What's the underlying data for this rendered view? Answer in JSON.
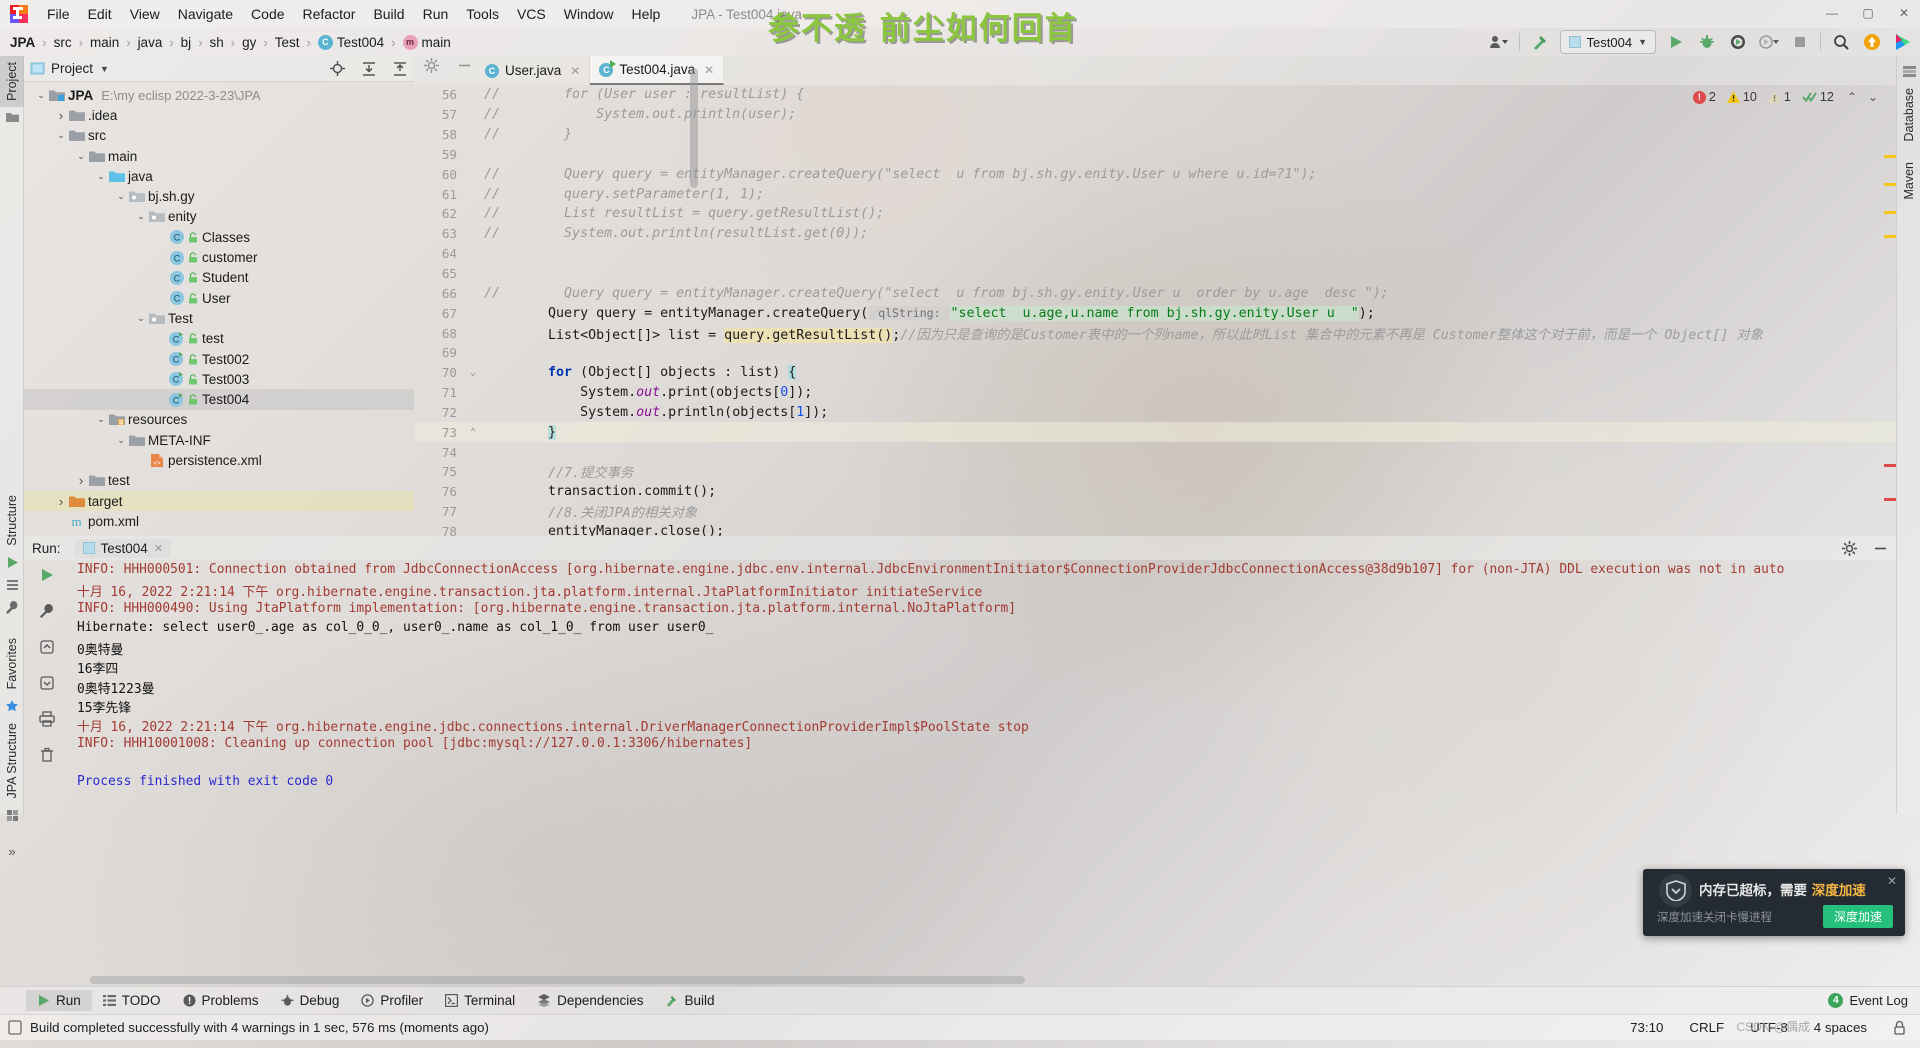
{
  "window": {
    "title": "JPA - Test004.java",
    "watermark": "参不透 前尘如何回首",
    "minimize": "—",
    "maximize": "▢",
    "close": "✕"
  },
  "menubar": {
    "items": [
      "File",
      "Edit",
      "View",
      "Navigate",
      "Code",
      "Refactor",
      "Build",
      "Run",
      "Tools",
      "VCS",
      "Window",
      "Help"
    ]
  },
  "breadcrumb": {
    "items": [
      {
        "label": "JPA",
        "icon": "",
        "bold": true
      },
      {
        "label": "src",
        "icon": ""
      },
      {
        "label": "main",
        "icon": ""
      },
      {
        "label": "java",
        "icon": ""
      },
      {
        "label": "bj",
        "icon": ""
      },
      {
        "label": "sh",
        "icon": ""
      },
      {
        "label": "gy",
        "icon": ""
      },
      {
        "label": "Test",
        "icon": ""
      },
      {
        "label": "Test004",
        "icon": "class-icon"
      },
      {
        "label": "main",
        "icon": "method-icon"
      }
    ]
  },
  "toolbar": {
    "run_config": "Test004",
    "icons": [
      "user-dropdown-icon",
      "build-hammer-icon",
      "run-icon",
      "debug-icon",
      "run-coverage-icon",
      "profiler-icon",
      "stop-icon",
      "search-everywhere-icon",
      "update-icon",
      "idea-feature-icon"
    ]
  },
  "left_strip": {
    "labels": [
      "Project",
      "Structure",
      "Favorites",
      "JPA Structure"
    ]
  },
  "right_strip": {
    "labels": [
      "Database",
      "Maven"
    ]
  },
  "project_panel": {
    "title": "Project",
    "header_icons": [
      "locate-icon",
      "expand-all-icon",
      "collapse-all-icon",
      "settings-gear-icon",
      "hide-icon"
    ],
    "tree": [
      {
        "depth": 0,
        "caret": "v",
        "icon": "module-folder",
        "label": "JPA",
        "bold": true,
        "path": "E:\\my eclisp 2022-3-23\\JPA"
      },
      {
        "depth": 1,
        "caret": ">",
        "icon": "folder",
        "label": ".idea"
      },
      {
        "depth": 1,
        "caret": "v",
        "icon": "folder",
        "label": "src"
      },
      {
        "depth": 2,
        "caret": "v",
        "icon": "folder",
        "label": "main"
      },
      {
        "depth": 3,
        "caret": "v",
        "icon": "source-folder",
        "label": "java"
      },
      {
        "depth": 4,
        "caret": "v",
        "icon": "package",
        "label": "bj.sh.gy"
      },
      {
        "depth": 5,
        "caret": "v",
        "icon": "package",
        "label": "enity"
      },
      {
        "depth": 6,
        "caret": "",
        "icon": "class",
        "label": "Classes"
      },
      {
        "depth": 6,
        "caret": "",
        "icon": "class",
        "label": "customer"
      },
      {
        "depth": 6,
        "caret": "",
        "icon": "class",
        "label": "Student"
      },
      {
        "depth": 6,
        "caret": "",
        "icon": "class",
        "label": "User"
      },
      {
        "depth": 5,
        "caret": "v",
        "icon": "package",
        "label": "Test"
      },
      {
        "depth": 6,
        "caret": "",
        "icon": "runnable-class",
        "label": "test"
      },
      {
        "depth": 6,
        "caret": "",
        "icon": "runnable-class",
        "label": "Test002"
      },
      {
        "depth": 6,
        "caret": "",
        "icon": "runnable-class",
        "label": "Test003"
      },
      {
        "depth": 6,
        "caret": "",
        "icon": "runnable-class",
        "label": "Test004",
        "selected": true
      },
      {
        "depth": 3,
        "caret": "v",
        "icon": "resource-folder",
        "label": "resources"
      },
      {
        "depth": 4,
        "caret": "v",
        "icon": "folder",
        "label": "META-INF"
      },
      {
        "depth": 5,
        "caret": "",
        "icon": "xml-file",
        "label": "persistence.xml"
      },
      {
        "depth": 2,
        "caret": ">",
        "icon": "folder",
        "label": "test"
      },
      {
        "depth": 1,
        "caret": ">",
        "icon": "target-folder",
        "label": "target",
        "target": true
      },
      {
        "depth": 1,
        "caret": "",
        "icon": "maven-file",
        "label": "pom.xml"
      }
    ]
  },
  "editor": {
    "tabs": [
      {
        "label": "User.java",
        "icon": "class-icon",
        "active": false
      },
      {
        "label": "Test004.java",
        "icon": "runnable-class-icon",
        "active": true
      }
    ],
    "inspection": {
      "errors": "2",
      "warnings": "10",
      "weak_warnings": "1",
      "checks": "12"
    },
    "lines": [
      {
        "n": "56",
        "segs": [
          {
            "t": "//        for (User user : resultList) {",
            "c": "cm",
            "indent": 0
          }
        ]
      },
      {
        "n": "57",
        "segs": [
          {
            "t": "//            System.out.println(user);",
            "c": "cm",
            "indent": 0
          }
        ]
      },
      {
        "n": "58",
        "segs": [
          {
            "t": "//        }",
            "c": "cm",
            "indent": 0
          }
        ]
      },
      {
        "n": "59",
        "segs": []
      },
      {
        "n": "60",
        "segs": [
          {
            "t": "//        Query query = entityManager.createQuery(\"select  u from bj.sh.gy.enity.User u where u.id=?1\");",
            "c": "cm",
            "indent": 0
          }
        ]
      },
      {
        "n": "61",
        "segs": [
          {
            "t": "//        query.setParameter(1, 1);",
            "c": "cm",
            "indent": 0
          }
        ]
      },
      {
        "n": "62",
        "segs": [
          {
            "t": "//        List resultList = query.getResultList();",
            "c": "cm",
            "indent": 0
          }
        ]
      },
      {
        "n": "63",
        "segs": [
          {
            "t": "//        System.out.println(resultList.get(0));",
            "c": "cm",
            "indent": 0
          }
        ]
      },
      {
        "n": "64",
        "segs": []
      },
      {
        "n": "65",
        "segs": []
      },
      {
        "n": "66",
        "segs": [
          {
            "t": "//        Query query = entityManager.createQuery(\"select  u from bj.sh.gy.enity.User u  order by u.age  desc \");",
            "c": "cm",
            "indent": 0
          }
        ]
      },
      {
        "n": "67",
        "segs": [
          {
            "t": "        Query query = entityManager.createQuery(",
            "c": "plain"
          },
          {
            "t": " qlString: ",
            "c": "hint"
          },
          {
            "t": "\"select  u.age,u.name from bj.sh.gy.enity.User u  \"",
            "c": "str hl-str"
          },
          {
            "t": ");",
            "c": "plain"
          }
        ]
      },
      {
        "n": "68",
        "segs": [
          {
            "t": "        List<Object[]> list = ",
            "c": "plain"
          },
          {
            "t": "query.getResultList()",
            "c": "plain hl-ident"
          },
          {
            "t": ";",
            "c": "plain"
          },
          {
            "t": "//因为只是查询的是Customer表中的一个列name，所以此时List 集合中的元素不再是 Customer整体这个对于前，而是一个 Object[] 对象",
            "c": "cm"
          }
        ]
      },
      {
        "n": "69",
        "segs": []
      },
      {
        "n": "70",
        "segs": [
          {
            "t": "        ",
            "c": "plain"
          },
          {
            "t": "for",
            "c": "kw"
          },
          {
            "t": " (Object[] objects : list) ",
            "c": "plain"
          },
          {
            "t": "{",
            "c": "plain hl-brace"
          }
        ]
      },
      {
        "n": "71",
        "segs": [
          {
            "t": "            System.",
            "c": "plain"
          },
          {
            "t": "out",
            "c": "fld"
          },
          {
            "t": ".print(objects[",
            "c": "plain"
          },
          {
            "t": "0",
            "c": "num"
          },
          {
            "t": "]);",
            "c": "plain"
          }
        ]
      },
      {
        "n": "72",
        "segs": [
          {
            "t": "            System.",
            "c": "plain"
          },
          {
            "t": "out",
            "c": "fld"
          },
          {
            "t": ".println(objects[",
            "c": "plain"
          },
          {
            "t": "1",
            "c": "num"
          },
          {
            "t": "]);",
            "c": "plain"
          }
        ]
      },
      {
        "n": "73",
        "segs": [
          {
            "t": "        ",
            "c": "plain"
          },
          {
            "t": "}",
            "c": "plain hl-brace"
          }
        ],
        "current": true
      },
      {
        "n": "74",
        "segs": []
      },
      {
        "n": "75",
        "segs": [
          {
            "t": "        //7.提交事务",
            "c": "cm"
          }
        ]
      },
      {
        "n": "76",
        "segs": [
          {
            "t": "        transaction.commit();",
            "c": "plain"
          }
        ]
      },
      {
        "n": "77",
        "segs": [
          {
            "t": "        //8.关闭JPA的相关对象",
            "c": "cm"
          }
        ]
      },
      {
        "n": "78",
        "segs": [
          {
            "t": "        entityManager.close();",
            "c": "plain"
          }
        ]
      }
    ]
  },
  "run_panel": {
    "label": "Run:",
    "tab": "Test004",
    "side_icons": [
      "rerun-icon",
      "stop-icon",
      "wrench-icon",
      "scroll-up-icon",
      "scroll-down-icon",
      "print-icon",
      "trash-icon"
    ],
    "head_icons": [
      "settings-gear-icon",
      "hide-icon"
    ],
    "console": [
      {
        "t": "INFO: HHH000501: Connection obtained from JdbcConnectionAccess [org.hibernate.engine.jdbc.env.internal.JdbcEnvironmentInitiator$ConnectionProviderJdbcConnectionAccess@38d9b107] for (non-JTA) DDL execution was not in auto",
        "c": "c-red"
      },
      {
        "t": "十月 16, 2022 2:21:14 下午 org.hibernate.engine.transaction.jta.platform.internal.JtaPlatformInitiator initiateService",
        "c": "c-red"
      },
      {
        "t": "INFO: HHH000490: Using JtaPlatform implementation: [org.hibernate.engine.transaction.jta.platform.internal.NoJtaPlatform]",
        "c": "c-red"
      },
      {
        "t": "Hibernate: select user0_.age as col_0_0_, user0_.name as col_1_0_ from user user0_",
        "c": "c-blk"
      },
      {
        "t": "0奥特曼",
        "c": "c-blk"
      },
      {
        "t": "16李四",
        "c": "c-blk"
      },
      {
        "t": "0奥特1223曼",
        "c": "c-blk"
      },
      {
        "t": "15李先锋",
        "c": "c-blk"
      },
      {
        "t": "十月 16, 2022 2:21:14 下午 org.hibernate.engine.jdbc.connections.internal.DriverManagerConnectionProviderImpl$PoolState stop",
        "c": "c-red"
      },
      {
        "t": "INFO: HHH10001008: Cleaning up connection pool [jdbc:mysql://127.0.0.1:3306/hibernates]",
        "c": "c-red"
      },
      {
        "t": "",
        "c": "c-blk"
      },
      {
        "t": "Process finished with exit code 0",
        "c": "c-blue"
      }
    ]
  },
  "notification": {
    "title_prefix": "内存已超标，需要 ",
    "title_accent": "深度加速",
    "subtitle": "深度加速关闭卡慢进程",
    "button": "深度加速",
    "close": "✕"
  },
  "bottom_bar": {
    "tabs": [
      {
        "label": "Run",
        "icon": "run-icon",
        "active": true
      },
      {
        "label": "TODO",
        "icon": "todo-icon"
      },
      {
        "label": "Problems",
        "icon": "problems-icon"
      },
      {
        "label": "Debug",
        "icon": "debug-icon"
      },
      {
        "label": "Profiler",
        "icon": "profiler-icon"
      },
      {
        "label": "Terminal",
        "icon": "terminal-icon"
      },
      {
        "label": "Dependencies",
        "icon": "dependencies-icon"
      },
      {
        "label": "Build",
        "icon": "build-icon"
      }
    ],
    "event_log": {
      "label": "Event Log",
      "count": "4"
    }
  },
  "status_bar": {
    "message": "Build completed successfully with 4 warnings in 1 sec, 576 ms (moments ago)",
    "caret": "73:10",
    "line_separator": "CRLF",
    "encoding": "UTF-8",
    "indent": "4 spaces",
    "lock_icon": "lock-icon"
  },
  "watermark_csdn": "CSDN @偶成"
}
